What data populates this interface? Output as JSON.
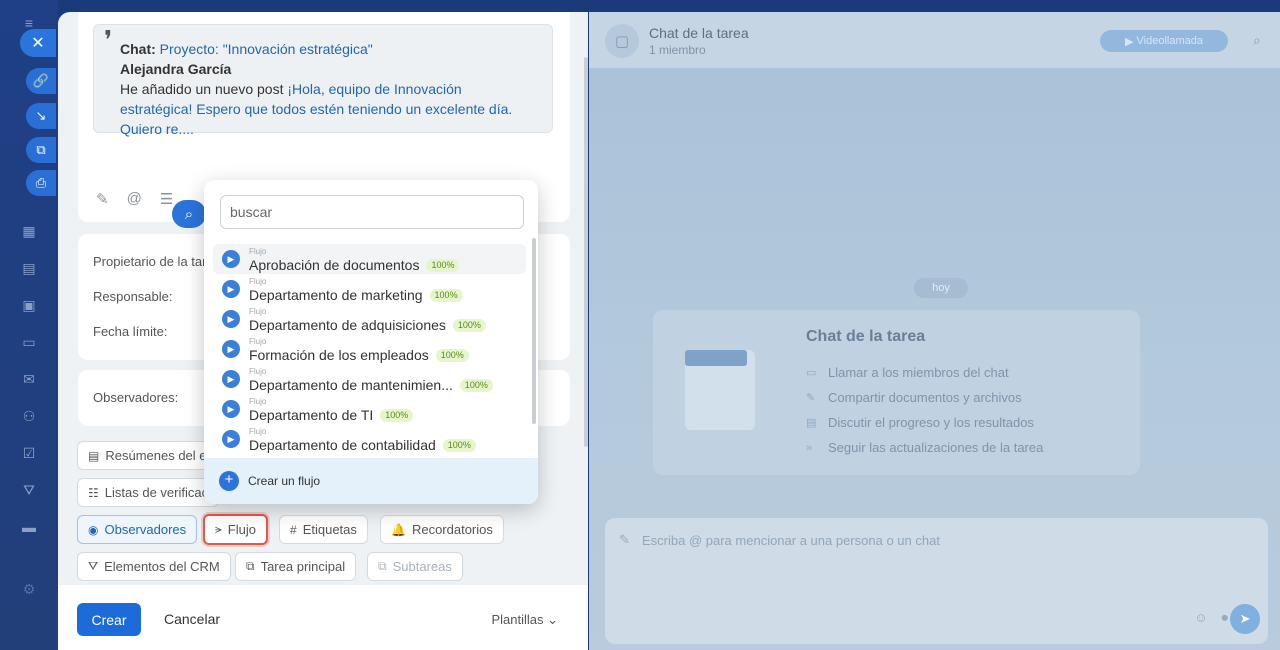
{
  "editor": {
    "quote_label": "Chat:",
    "quote_project": "Proyecto: \"Innovación estratégica\"",
    "quote_author": "Alejandra García",
    "quote_text": "He añadido un nuevo post",
    "quote_link": "¡Hola, equipo de Innovación estratégica! Espero que todos estén teniendo un excelente día. Quiero re...."
  },
  "fields": {
    "owner_label": "Propietario de la tar",
    "responsible_label": "Responsable:",
    "deadline_label": "Fecha límite:",
    "observers_label": "Observadores:"
  },
  "chips": {
    "summaries": "Resúmenes del es",
    "checklists": "Listas de verificac",
    "observers": "Observadores",
    "flow": "Flujo",
    "tags": "Etiquetas",
    "reminders": "Recordatorios",
    "crm": "Elementos del CRM",
    "parent_task": "Tarea principal",
    "subtasks": "Subtareas"
  },
  "footer": {
    "create": "Crear",
    "cancel": "Cancelar",
    "templates": "Plantillas"
  },
  "chat": {
    "title": "Chat de la tarea",
    "subtitle": "1 miembro",
    "video_call": "Videollamada",
    "day": "hoy",
    "intro_title": "Chat de la tarea",
    "intro_items": [
      "Llamar a los miembros del chat",
      "Compartir documentos y archivos",
      "Discutir el progreso y los resultados",
      "Seguir las actualizaciones de la tarea"
    ],
    "composer_placeholder": "Escriba @ para mencionar a una persona o un chat"
  },
  "popup": {
    "search_placeholder": "buscar",
    "flows": [
      {
        "type": "Flujo",
        "name": "Aprobación de documentos",
        "efficiency": "100%"
      },
      {
        "type": "Flujo",
        "name": "Departamento de marketing",
        "efficiency": "100%"
      },
      {
        "type": "Flujo",
        "name": "Departamento de adquisiciones",
        "efficiency": "100%"
      },
      {
        "type": "Flujo",
        "name": "Formación de los empleados",
        "efficiency": "100%"
      },
      {
        "type": "Flujo",
        "name": "Departamento de mantenimien...",
        "efficiency": "100%"
      },
      {
        "type": "Flujo",
        "name": "Departamento de TI",
        "efficiency": "100%"
      },
      {
        "type": "Flujo",
        "name": "Departamento de contabilidad",
        "efficiency": "100%"
      }
    ],
    "create_flow": "Crear un flujo"
  },
  "colors": {
    "accent": "#1d6bd8",
    "highlight_border": "#e05a4c",
    "badge_bg": "#e6f6cc"
  }
}
